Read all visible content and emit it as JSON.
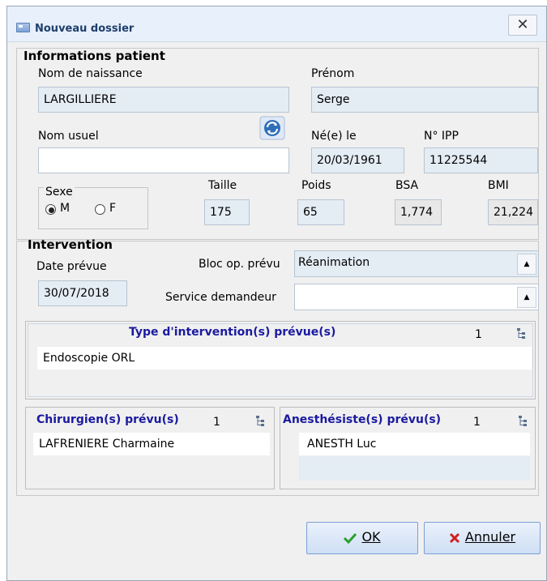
{
  "window": {
    "title": "Nouveau dossier",
    "close": "✕"
  },
  "patient": {
    "section_title": "Informations patient",
    "nom_naissance_label": "Nom de naissance",
    "nom_naissance": "LARGILLIERE",
    "prenom_label": "Prénom",
    "prenom": "Serge",
    "nom_usuel_label": "Nom usuel",
    "nom_usuel": "",
    "ne_le_label": "Né(e) le",
    "ne_le": "20/03/1961",
    "ipp_label": "N° IPP",
    "ipp": "11225544",
    "sexe_label": "Sexe",
    "sexe_m": "M",
    "sexe_f": "F",
    "taille_label": "Taille",
    "taille": "175",
    "poids_label": "Poids",
    "poids": "65",
    "bsa_label": "BSA",
    "bsa": "1,774",
    "bmi_label": "BMI",
    "bmi": "21,224"
  },
  "intervention": {
    "section_title": "Intervention",
    "date_label": "Date prévue",
    "date": "30/07/2018",
    "bloc_label": "Bloc op. prévu",
    "bloc_value": "Réanimation",
    "service_label": "Service demandeur",
    "service_value": "",
    "type_title": "Type d'intervention(s) prévue(s)",
    "type_count": "1",
    "type_items": [
      "Endoscopie ORL"
    ],
    "chirurgien_title": "Chirurgien(s) prévu(s)",
    "chirurgien_count": "1",
    "chirurgien_items": [
      "LAFRENIERE Charmaine"
    ],
    "anesth_title": "Anesthésiste(s) prévu(s)",
    "anesth_count": "1",
    "anesth_items": [
      "ANESTH Luc"
    ]
  },
  "buttons": {
    "ok": "OK",
    "annuler": "Annuler"
  },
  "colors": {
    "accent_blue": "#1a1aa0",
    "ok_check": "#2aa02a",
    "cancel_x": "#d02020"
  }
}
